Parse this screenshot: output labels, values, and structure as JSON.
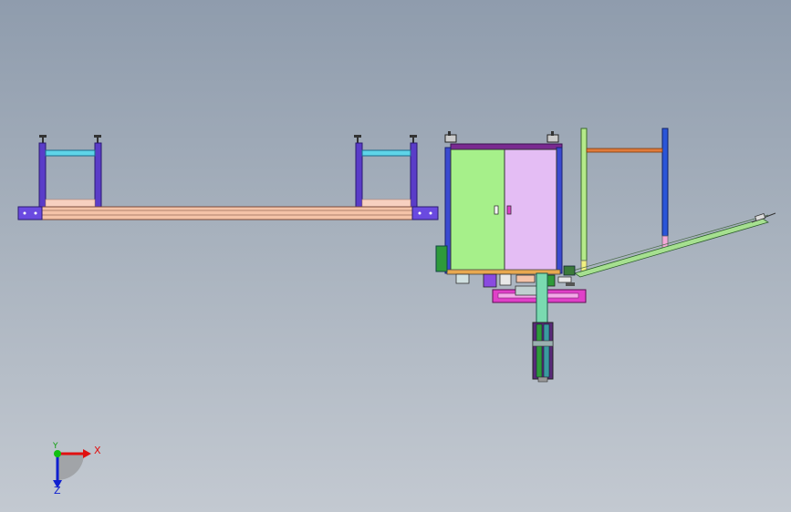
{
  "viewport": {
    "background_top": "#8f9cad",
    "background_bottom": "#c3c9d1"
  },
  "triad": {
    "x_label": "X",
    "y_label": "Y",
    "z_label": "Z",
    "x_color": "#e01010",
    "y_color": "#10c010",
    "z_color": "#1020d0"
  },
  "model": {
    "frame_color": "#5a3cc8",
    "beam_color": "#f4c3a8",
    "crossbar_color": "#5ed4e8",
    "cabinet_left_color": "#a6f08a",
    "cabinet_right_color": "#e4bdf4",
    "post_green_color": "#b5ea8a",
    "post_blue_color": "#2a55d8",
    "crossbar_orange_color": "#e07a3a",
    "accent_magenta": "#e040c8"
  }
}
